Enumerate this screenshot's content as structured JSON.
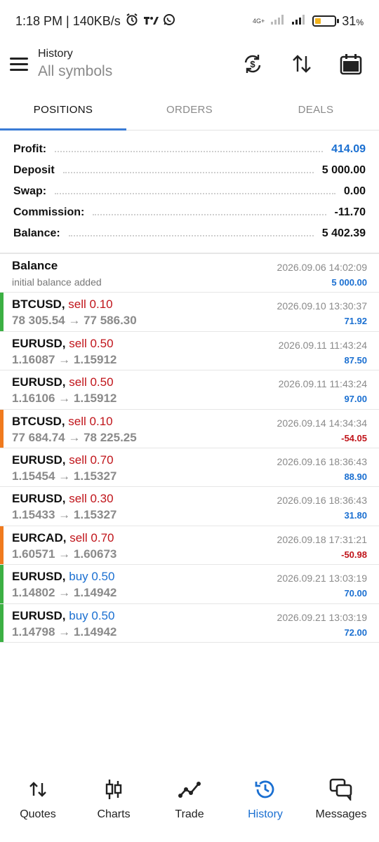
{
  "status_bar": {
    "time_speed": "1:18 PM | 140KB/s",
    "network_label": "4G+",
    "battery_percent": "31",
    "battery_level": 0.31,
    "battery_color": "#f2b31c"
  },
  "header": {
    "title": "History",
    "subtitle": "All symbols"
  },
  "tabs": [
    {
      "label": "POSITIONS",
      "active": true
    },
    {
      "label": "ORDERS",
      "active": false
    },
    {
      "label": "DEALS",
      "active": false
    }
  ],
  "summary": {
    "profit_label": "Profit:",
    "profit_value": "414.09",
    "deposit_label": "Deposit",
    "deposit_value": "5 000.00",
    "swap_label": "Swap:",
    "swap_value": "0.00",
    "commission_label": "Commission:",
    "commission_value": "-11.70",
    "balance_label": "Balance:",
    "balance_value": "5 402.39"
  },
  "records": [
    {
      "symbol": "Balance",
      "side": "",
      "side_type": "",
      "detail": "initial balance added",
      "date": "2026.09.06 14:02:09",
      "amount": "5 000.00",
      "amount_sign": "pos",
      "bar_color": ""
    },
    {
      "symbol": "BTCUSD,",
      "side": "sell 0.10",
      "side_type": "sell",
      "detail": "78 305.54 → 77 586.30",
      "date": "2026.09.10 13:30:37",
      "amount": "71.92",
      "amount_sign": "pos",
      "bar_color": "#3cb043"
    },
    {
      "symbol": "EURUSD,",
      "side": "sell 0.50",
      "side_type": "sell",
      "detail": "1.16087 → 1.15912",
      "date": "2026.09.11 11:43:24",
      "amount": "87.50",
      "amount_sign": "pos",
      "bar_color": ""
    },
    {
      "symbol": "EURUSD,",
      "side": "sell 0.50",
      "side_type": "sell",
      "detail": "1.16106 → 1.15912",
      "date": "2026.09.11 11:43:24",
      "amount": "97.00",
      "amount_sign": "pos",
      "bar_color": ""
    },
    {
      "symbol": "BTCUSD,",
      "side": "sell 0.10",
      "side_type": "sell",
      "detail": "77 684.74 → 78 225.25",
      "date": "2026.09.14 14:34:34",
      "amount": "-54.05",
      "amount_sign": "neg",
      "bar_color": "#f07a1e"
    },
    {
      "symbol": "EURUSD,",
      "side": "sell 0.70",
      "side_type": "sell",
      "detail": "1.15454 → 1.15327",
      "date": "2026.09.16 18:36:43",
      "amount": "88.90",
      "amount_sign": "pos",
      "bar_color": ""
    },
    {
      "symbol": "EURUSD,",
      "side": "sell 0.30",
      "side_type": "sell",
      "detail": "1.15433 → 1.15327",
      "date": "2026.09.16 18:36:43",
      "amount": "31.80",
      "amount_sign": "pos",
      "bar_color": ""
    },
    {
      "symbol": "EURCAD,",
      "side": "sell 0.70",
      "side_type": "sell",
      "detail": "1.60571 → 1.60673",
      "date": "2026.09.18 17:31:21",
      "amount": "-50.98",
      "amount_sign": "neg",
      "bar_color": "#f07a1e"
    },
    {
      "symbol": "EURUSD,",
      "side": "buy 0.50",
      "side_type": "buy",
      "detail": "1.14802 → 1.14942",
      "date": "2026.09.21 13:03:19",
      "amount": "70.00",
      "amount_sign": "pos",
      "bar_color": "#3cb043"
    },
    {
      "symbol": "EURUSD,",
      "side": "buy 0.50",
      "side_type": "buy",
      "detail": "1.14798 → 1.14942",
      "date": "2026.09.21 13:03:19",
      "amount": "72.00",
      "amount_sign": "pos",
      "bar_color": "#3cb043"
    }
  ],
  "bottom_nav": [
    {
      "label": "Quotes",
      "icon": "quotes-icon",
      "active": false
    },
    {
      "label": "Charts",
      "icon": "charts-icon",
      "active": false
    },
    {
      "label": "Trade",
      "icon": "trade-icon",
      "active": false
    },
    {
      "label": "History",
      "icon": "history-icon",
      "active": true
    },
    {
      "label": "Messages",
      "icon": "messages-icon",
      "active": false
    }
  ],
  "colors": {
    "accent_blue": "#1a6fd1",
    "sell_red": "#c0141a",
    "profit_green_bar": "#3cb043",
    "loss_orange_bar": "#f07a1e"
  }
}
